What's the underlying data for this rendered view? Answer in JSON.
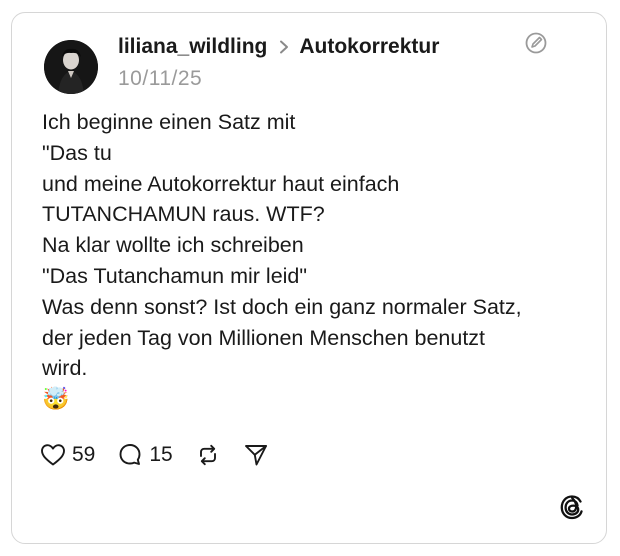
{
  "post": {
    "author": "liliana_wildling",
    "topic": "Autokorrektur",
    "date": "10/11/25",
    "lines": [
      "Ich beginne einen Satz mit",
      "\"Das tu",
      "und meine Autokorrektur haut einfach",
      "TUTANCHAMUN raus. WTF?",
      "Na klar wollte ich schreiben",
      "\"Das Tutanchamun mir leid\"",
      "Was denn sonst? Ist doch ein ganz normaler Satz,",
      "der jeden Tag von Millionen Menschen benutzt",
      "wird."
    ],
    "emoji": "🤯"
  },
  "actions": {
    "likes": "59",
    "replies": "15"
  },
  "icons": {
    "avatar": "avatar",
    "chevron": "chevron-right-icon",
    "edit": "edit-off-icon",
    "like": "heart-icon",
    "reply": "comment-icon",
    "repost": "repost-icon",
    "share": "send-icon",
    "brand": "threads-logo-icon"
  }
}
